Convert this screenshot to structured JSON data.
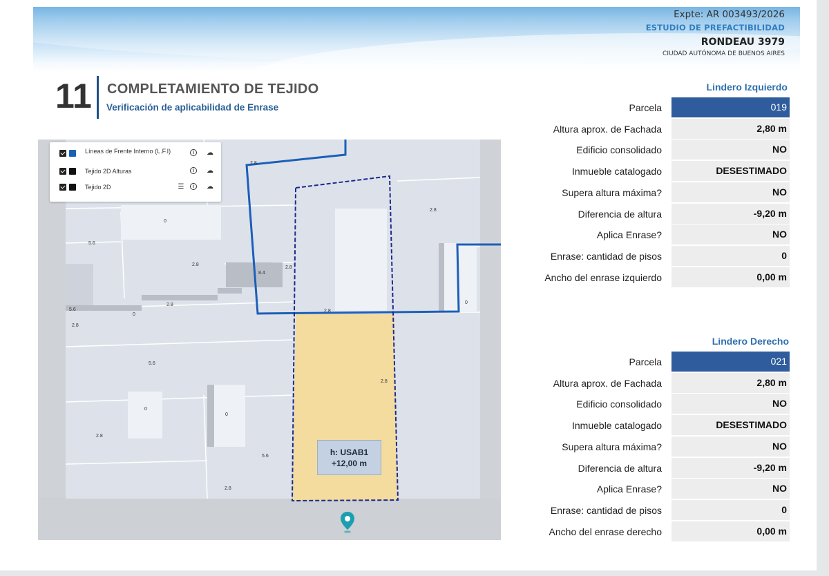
{
  "header": {
    "expte": "Expte: AR 003493/2026",
    "estudio": "ESTUDIO DE PREFACTIBILIDAD",
    "address": "RONDEAU 3979",
    "city": "CIUDAD AUTÓNOMA DE BUENOS AIRES"
  },
  "section": {
    "number": "11",
    "title": "COMPLETAMIENTO DE TEJIDO",
    "subtitle": "Verificación de aplicabilidad de Enrase"
  },
  "map": {
    "legend": [
      {
        "label": "Líneas de Frente Interno (L.F.I)",
        "swatch": "#1c5fb8",
        "icons": [
          "info-icon",
          "cloud-upload-icon"
        ]
      },
      {
        "label": "Tejido 2D Alturas",
        "swatch": "#111111",
        "icons": [
          "info-icon",
          "cloud-upload-icon"
        ]
      },
      {
        "label": "Tejido 2D",
        "swatch": "#111111",
        "icons": [
          "list-icon",
          "info-icon",
          "cloud-upload-icon"
        ]
      }
    ],
    "labels": [
      "2.8",
      "0",
      "5.6",
      "2.8",
      "8.4",
      "2.8",
      "2.8",
      "5.6",
      "0",
      "2.8",
      "2.8",
      "0",
      "5.6",
      "2.8",
      "0",
      "0",
      "2.8",
      "5.6",
      "2.8",
      "2.8"
    ],
    "popup_line1": "h: USAB1",
    "popup_line2": "+12,00 m",
    "pin_icon": "location-pin-icon",
    "colors": {
      "lfi": "#1c5fb8",
      "parcel_dash": "#1d2a8c",
      "parcel_fill": "#f3dc9e"
    }
  },
  "left_neighbor": {
    "heading": "Lindero Izquierdo",
    "rows": [
      {
        "label": "Parcela",
        "value": "019"
      },
      {
        "label": "Altura aprox. de Fachada",
        "value": "2,80 m"
      },
      {
        "label": "Edificio consolidado",
        "value": "NO"
      },
      {
        "label": "Inmueble catalogado",
        "value": "DESESTIMADO"
      },
      {
        "label": "Supera altura máxima?",
        "value": "NO"
      },
      {
        "label": "Diferencia de altura",
        "value": "-9,20 m"
      },
      {
        "label": "Aplica Enrase?",
        "value": "NO"
      },
      {
        "label": "Enrase: cantidad de pisos",
        "value": "0"
      },
      {
        "label": "Ancho del enrase izquierdo",
        "value": "0,00 m"
      }
    ]
  },
  "right_neighbor": {
    "heading": "Lindero Derecho",
    "rows": [
      {
        "label": "Parcela",
        "value": "021"
      },
      {
        "label": "Altura aprox. de Fachada",
        "value": "2,80 m"
      },
      {
        "label": "Edificio consolidado",
        "value": "NO"
      },
      {
        "label": "Inmueble catalogado",
        "value": "DESESTIMADO"
      },
      {
        "label": "Supera altura máxima?",
        "value": "NO"
      },
      {
        "label": "Diferencia de altura",
        "value": "-9,20 m"
      },
      {
        "label": "Aplica Enrase?",
        "value": "NO"
      },
      {
        "label": "Enrase: cantidad de pisos",
        "value": "0"
      },
      {
        "label": "Ancho del enrase derecho",
        "value": "0,00 m"
      }
    ]
  }
}
